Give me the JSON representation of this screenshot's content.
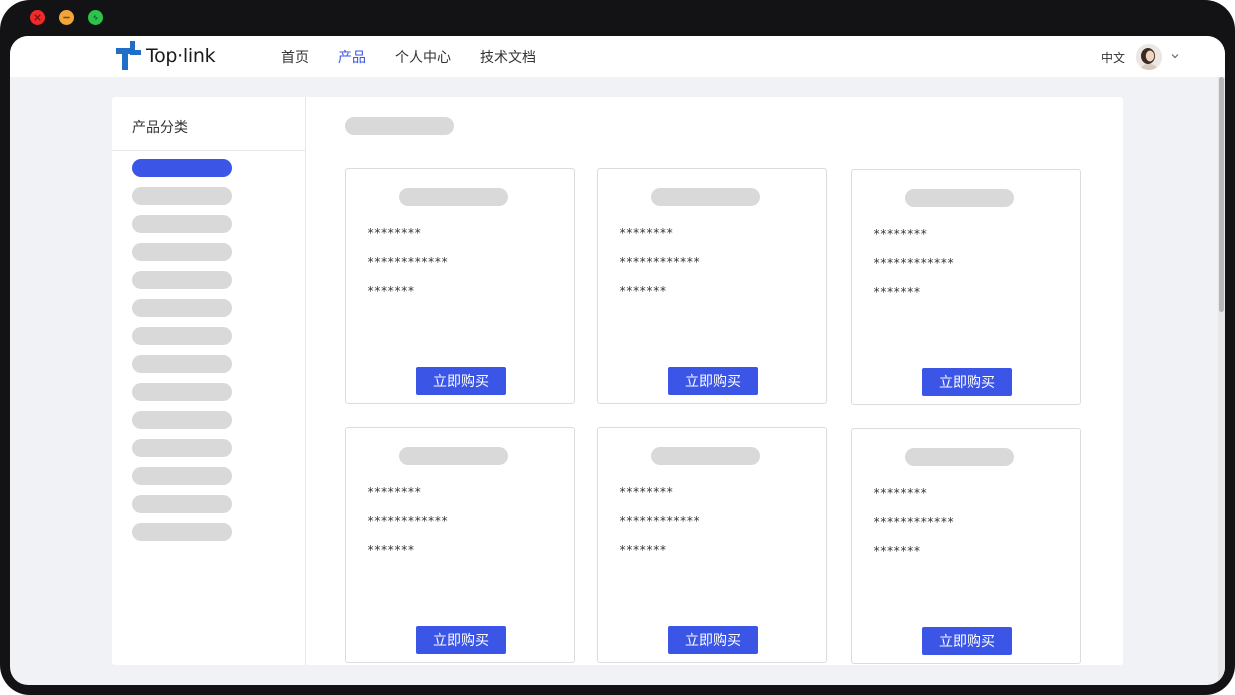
{
  "window": {
    "close_color": "#ee2b2b",
    "minimize_color": "#f3a53a",
    "maximize_color": "#2dc249"
  },
  "header": {
    "logo_text": "Top·link",
    "nav": [
      {
        "label": "首页",
        "active": false
      },
      {
        "label": "产品",
        "active": true
      },
      {
        "label": "个人中心",
        "active": false
      },
      {
        "label": "技术文档",
        "active": false
      }
    ],
    "language": "中文"
  },
  "sidebar": {
    "title": "产品分类",
    "item_count": 14,
    "active_index": 0
  },
  "products": [
    {
      "line1": "********",
      "line2": "************",
      "line3": "*******",
      "button": "立即购买"
    },
    {
      "line1": "********",
      "line2": "************",
      "line3": "*******",
      "button": "立即购买"
    },
    {
      "line1": "********",
      "line2": "************",
      "line3": "*******",
      "button": "立即购买"
    },
    {
      "line1": "********",
      "line2": "************",
      "line3": "*******",
      "button": "立即购买"
    },
    {
      "line1": "********",
      "line2": "************",
      "line3": "*******",
      "button": "立即购买"
    },
    {
      "line1": "********",
      "line2": "************",
      "line3": "*******",
      "button": "立即购买"
    }
  ],
  "colors": {
    "accent": "#3b55e6",
    "skeleton": "#d9d9d9",
    "background": "#f0f2f5"
  }
}
